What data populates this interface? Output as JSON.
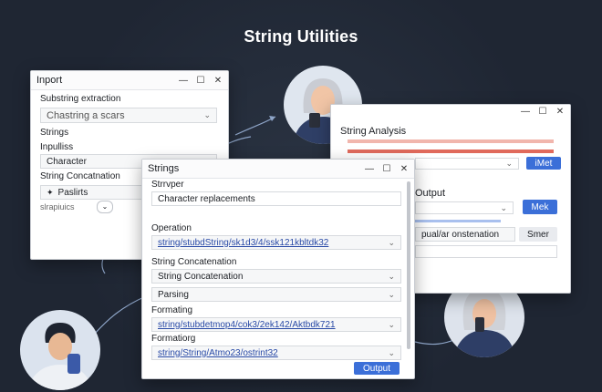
{
  "page": {
    "title": "String Utilities"
  },
  "win_import": {
    "title": "Inport",
    "sec1_label": "Substring extraction",
    "sec1_value": "Chastring a scars",
    "item_strings": "Strings",
    "item_inpulliss": "Inpulliss",
    "field_character": "Character",
    "item_concat": "String Concatnation",
    "field_paslirts": "Paslirts",
    "footer_text": "slrapiuics"
  },
  "win_analysis": {
    "title": "String Analysis",
    "output_label": "Output",
    "btn_imet": "iMet",
    "btn_mek": "Mek",
    "field_text": "pual/ar onstenation",
    "btn_smer": "Smer"
  },
  "win_strings": {
    "title": "Strings",
    "strvper_label": "Strrvper",
    "strvper_value": "Character replacements",
    "operation_label": "Operation",
    "operation_value": "string/stubdString/sk1d3/4/ssk121kbltdk32",
    "concat_label": "String Concatenation",
    "concat_value": "String Concatenation",
    "parsing_value": "Parsing",
    "formating_label": "Formating",
    "formating_value": "string/stubdetmop4/cok3/2ek142/Aktbdk721",
    "formatiorg_label": "Formatiorg",
    "formatiorg_value": "string/String/Atmo23/ostrint32",
    "output_button": "Output"
  },
  "window_controls": {
    "minimize": "—",
    "maximize": "☐",
    "close": "✕"
  },
  "colors": {
    "background": "#1f2633",
    "accent_blue": "#3b6fd8",
    "link_blue": "#2849a6",
    "bar_red": "#e06a5c",
    "bar_pink": "#f1b6ad",
    "bar_blue": "#a9c0ee"
  },
  "icons": [
    "minimize-icon",
    "maximize-icon",
    "close-icon",
    "chevron-down-icon",
    "arrow-icon",
    "person-avatar"
  ]
}
